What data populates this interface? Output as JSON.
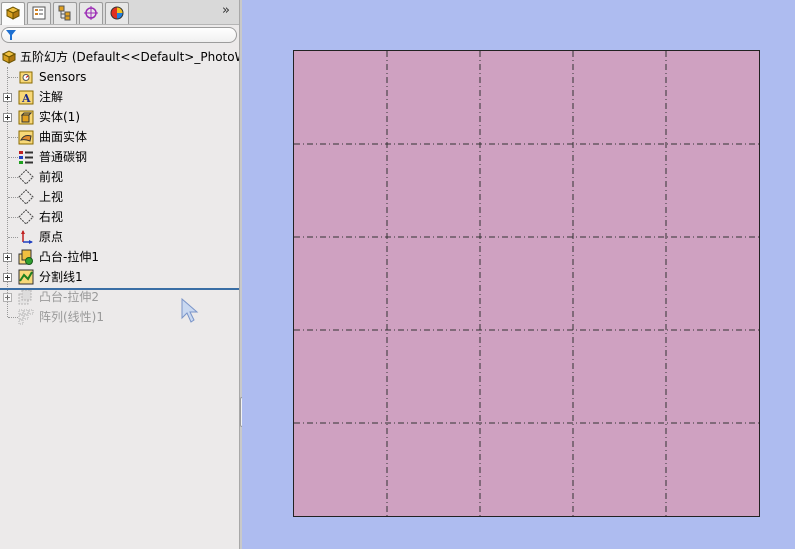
{
  "feature_manager": {
    "tabs": [
      {
        "name": "FeatureManager",
        "icon": "feature-tree-icon",
        "active": true
      },
      {
        "name": "PropertyManager",
        "icon": "property-manager-icon",
        "active": false
      },
      {
        "name": "ConfigurationManager",
        "icon": "configuration-manager-icon",
        "active": false
      },
      {
        "name": "DimXpertManager",
        "icon": "dimxpert-icon",
        "active": false
      },
      {
        "name": "DisplayManager",
        "icon": "display-manager-icon",
        "active": false
      }
    ],
    "more_label": "»",
    "filter_icon": "filter-icon",
    "tree": [
      {
        "label": "五阶幻方  (Default<<Default>_PhotoWorks>",
        "icon": "part-icon",
        "expandable": false,
        "dim": false
      },
      {
        "label": "Sensors",
        "icon": "sensors-icon",
        "expandable": false,
        "dim": false
      },
      {
        "label": "注解",
        "icon": "annotations-icon",
        "expandable": true,
        "dim": false
      },
      {
        "label": "实体(1)",
        "icon": "solid-bodies-icon",
        "expandable": true,
        "dim": false
      },
      {
        "label": "曲面实体",
        "icon": "surface-bodies-icon",
        "expandable": false,
        "dim": false
      },
      {
        "label": "普通碳钢",
        "icon": "material-icon",
        "expandable": false,
        "dim": false
      },
      {
        "label": "前视",
        "icon": "plane-icon",
        "expandable": false,
        "dim": false
      },
      {
        "label": "上视",
        "icon": "plane-icon",
        "expandable": false,
        "dim": false
      },
      {
        "label": "右视",
        "icon": "plane-icon",
        "expandable": false,
        "dim": false
      },
      {
        "label": "原点",
        "icon": "origin-icon",
        "expandable": false,
        "dim": false
      },
      {
        "label": "凸台-拉伸1",
        "icon": "boss-extrude-icon",
        "expandable": true,
        "dim": false
      },
      {
        "label": "分割线1",
        "icon": "split-line-icon",
        "expandable": true,
        "dim": false
      },
      {
        "label": "凸台-拉伸2",
        "icon": "boss-extrude-icon",
        "expandable": true,
        "dim": true
      },
      {
        "label": "阵列(线性)1",
        "icon": "linear-pattern-icon",
        "expandable": false,
        "dim": true
      }
    ]
  },
  "graphics_area": {
    "background": "#aebcf0",
    "face_color": "#cfa1c1",
    "grid_rows": 5,
    "grid_cols": 5
  }
}
